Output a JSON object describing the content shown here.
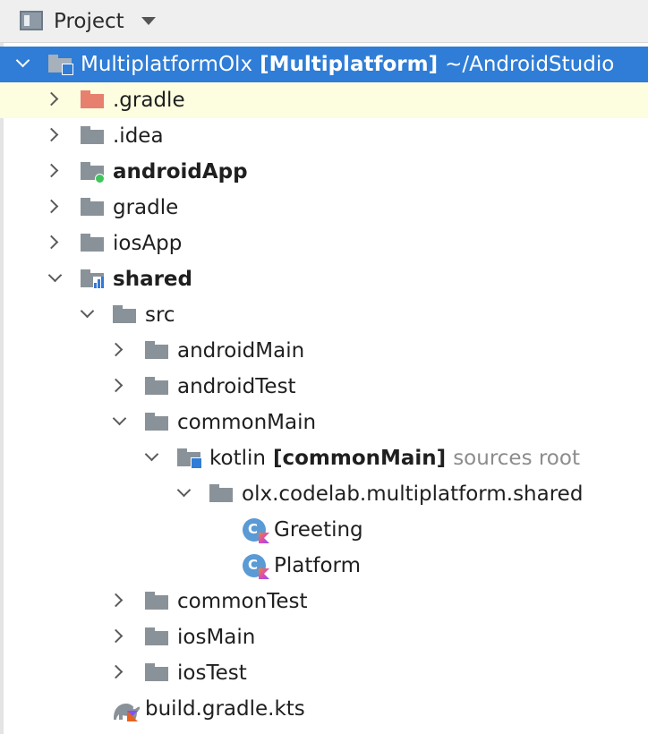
{
  "header": {
    "title": "Project",
    "view_icon": "project-view-icon",
    "menu_icon": "caret-down-icon"
  },
  "tree": {
    "root": {
      "label": "MultiplatformOlx",
      "tag": "[Multiplatform]",
      "path": "~/AndroidStudio"
    },
    "gradle_dir": ".gradle",
    "idea_dir": ".idea",
    "android_app": "androidApp",
    "gradle": "gradle",
    "ios_app": "iosApp",
    "shared": "shared",
    "src": "src",
    "android_main": "androidMain",
    "android_test": "androidTest",
    "common_main": "commonMain",
    "kotlin": {
      "label": "kotlin",
      "tag": "[commonMain]",
      "note": "sources root"
    },
    "package": "olx.codelab.multiplatform.shared",
    "greeting": "Greeting",
    "platform": "Platform",
    "common_test": "commonTest",
    "ios_main": "iosMain",
    "ios_test": "iosTest",
    "build_file": "build.gradle.kts"
  },
  "colors": {
    "selection": "#2f7dd6",
    "hover": "#fdfde0",
    "folder": "#8a9299",
    "excluded_folder": "#e8806f",
    "android_badge": "#3ec55c"
  }
}
